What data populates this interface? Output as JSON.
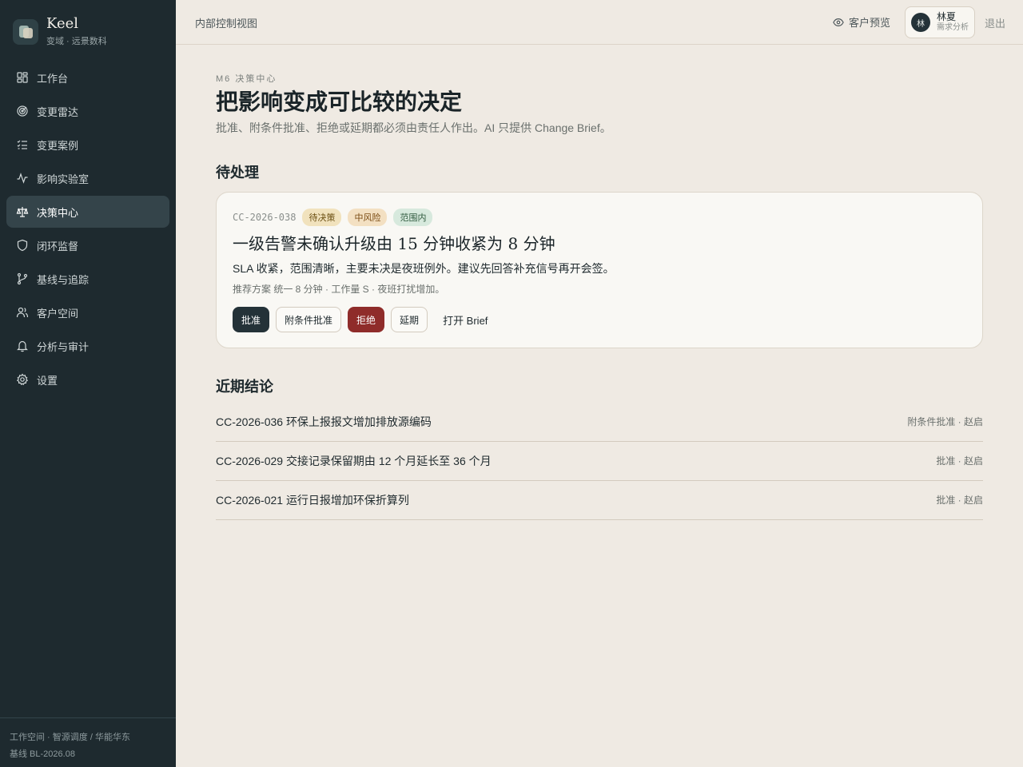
{
  "brand": {
    "name": "Keel",
    "subtitle": "变域 · 远景数科"
  },
  "sidebar": {
    "items": [
      {
        "label": "工作台",
        "icon": "dashboard-icon"
      },
      {
        "label": "变更雷达",
        "icon": "radar-icon"
      },
      {
        "label": "变更案例",
        "icon": "list-check-icon"
      },
      {
        "label": "影响实验室",
        "icon": "activity-icon"
      },
      {
        "label": "决策中心",
        "icon": "scale-icon",
        "active": true
      },
      {
        "label": "闭环监督",
        "icon": "shield-icon"
      },
      {
        "label": "基线与追踪",
        "icon": "git-branch-icon"
      },
      {
        "label": "客户空间",
        "icon": "users-icon"
      },
      {
        "label": "分析与审计",
        "icon": "bell-icon"
      },
      {
        "label": "设置",
        "icon": "gear-icon"
      }
    ],
    "footer": {
      "workspace": "工作空间 · 智源调度 / 华能华东",
      "baseline": "基线 BL-2026.08"
    }
  },
  "topbar": {
    "title": "内部控制视图",
    "preview_label": "客户预览",
    "user": {
      "avatar": "林",
      "name": "林夏",
      "role": "需求分析"
    },
    "logout_label": "退出"
  },
  "page": {
    "eyebrow": "M6 决策中心",
    "title": "把影响变成可比较的决定",
    "description": "批准、附条件批准、拒绝或延期都必须由责任人作出。AI 只提供 Change Brief。"
  },
  "pending": {
    "section_title": "待处理",
    "card": {
      "id": "CC-2026-038",
      "badges": {
        "status": "待决策",
        "risk": "中风险",
        "scope": "范围内"
      },
      "title": "一级告警未确认升级由 15 分钟收紧为 8 分钟",
      "summary": "SLA 收紧，范围清晰，主要未决是夜班例外。建议先回答补充信号再开会签。",
      "detail": "推荐方案 统一 8 分钟 · 工作量 S · 夜班打扰增加。",
      "actions": {
        "approve": "批准",
        "conditional": "附条件批准",
        "reject": "拒绝",
        "defer": "延期",
        "open_brief": "打开 Brief"
      }
    }
  },
  "recent": {
    "section_title": "近期结论",
    "rows": [
      {
        "title": "CC-2026-036 环保上报报文增加排放源编码",
        "meta": "附条件批准 · 赵启"
      },
      {
        "title": "CC-2026-029 交接记录保留期由 12 个月延长至 36 个月",
        "meta": "批准 · 赵启"
      },
      {
        "title": "CC-2026-021 运行日报增加环保折算列",
        "meta": "批准 · 赵启"
      }
    ]
  },
  "colors": {
    "sidebar_bg": "#1e2a2f",
    "page_bg": "#efeae3",
    "primary": "#243238",
    "danger": "#8f2c2a"
  }
}
